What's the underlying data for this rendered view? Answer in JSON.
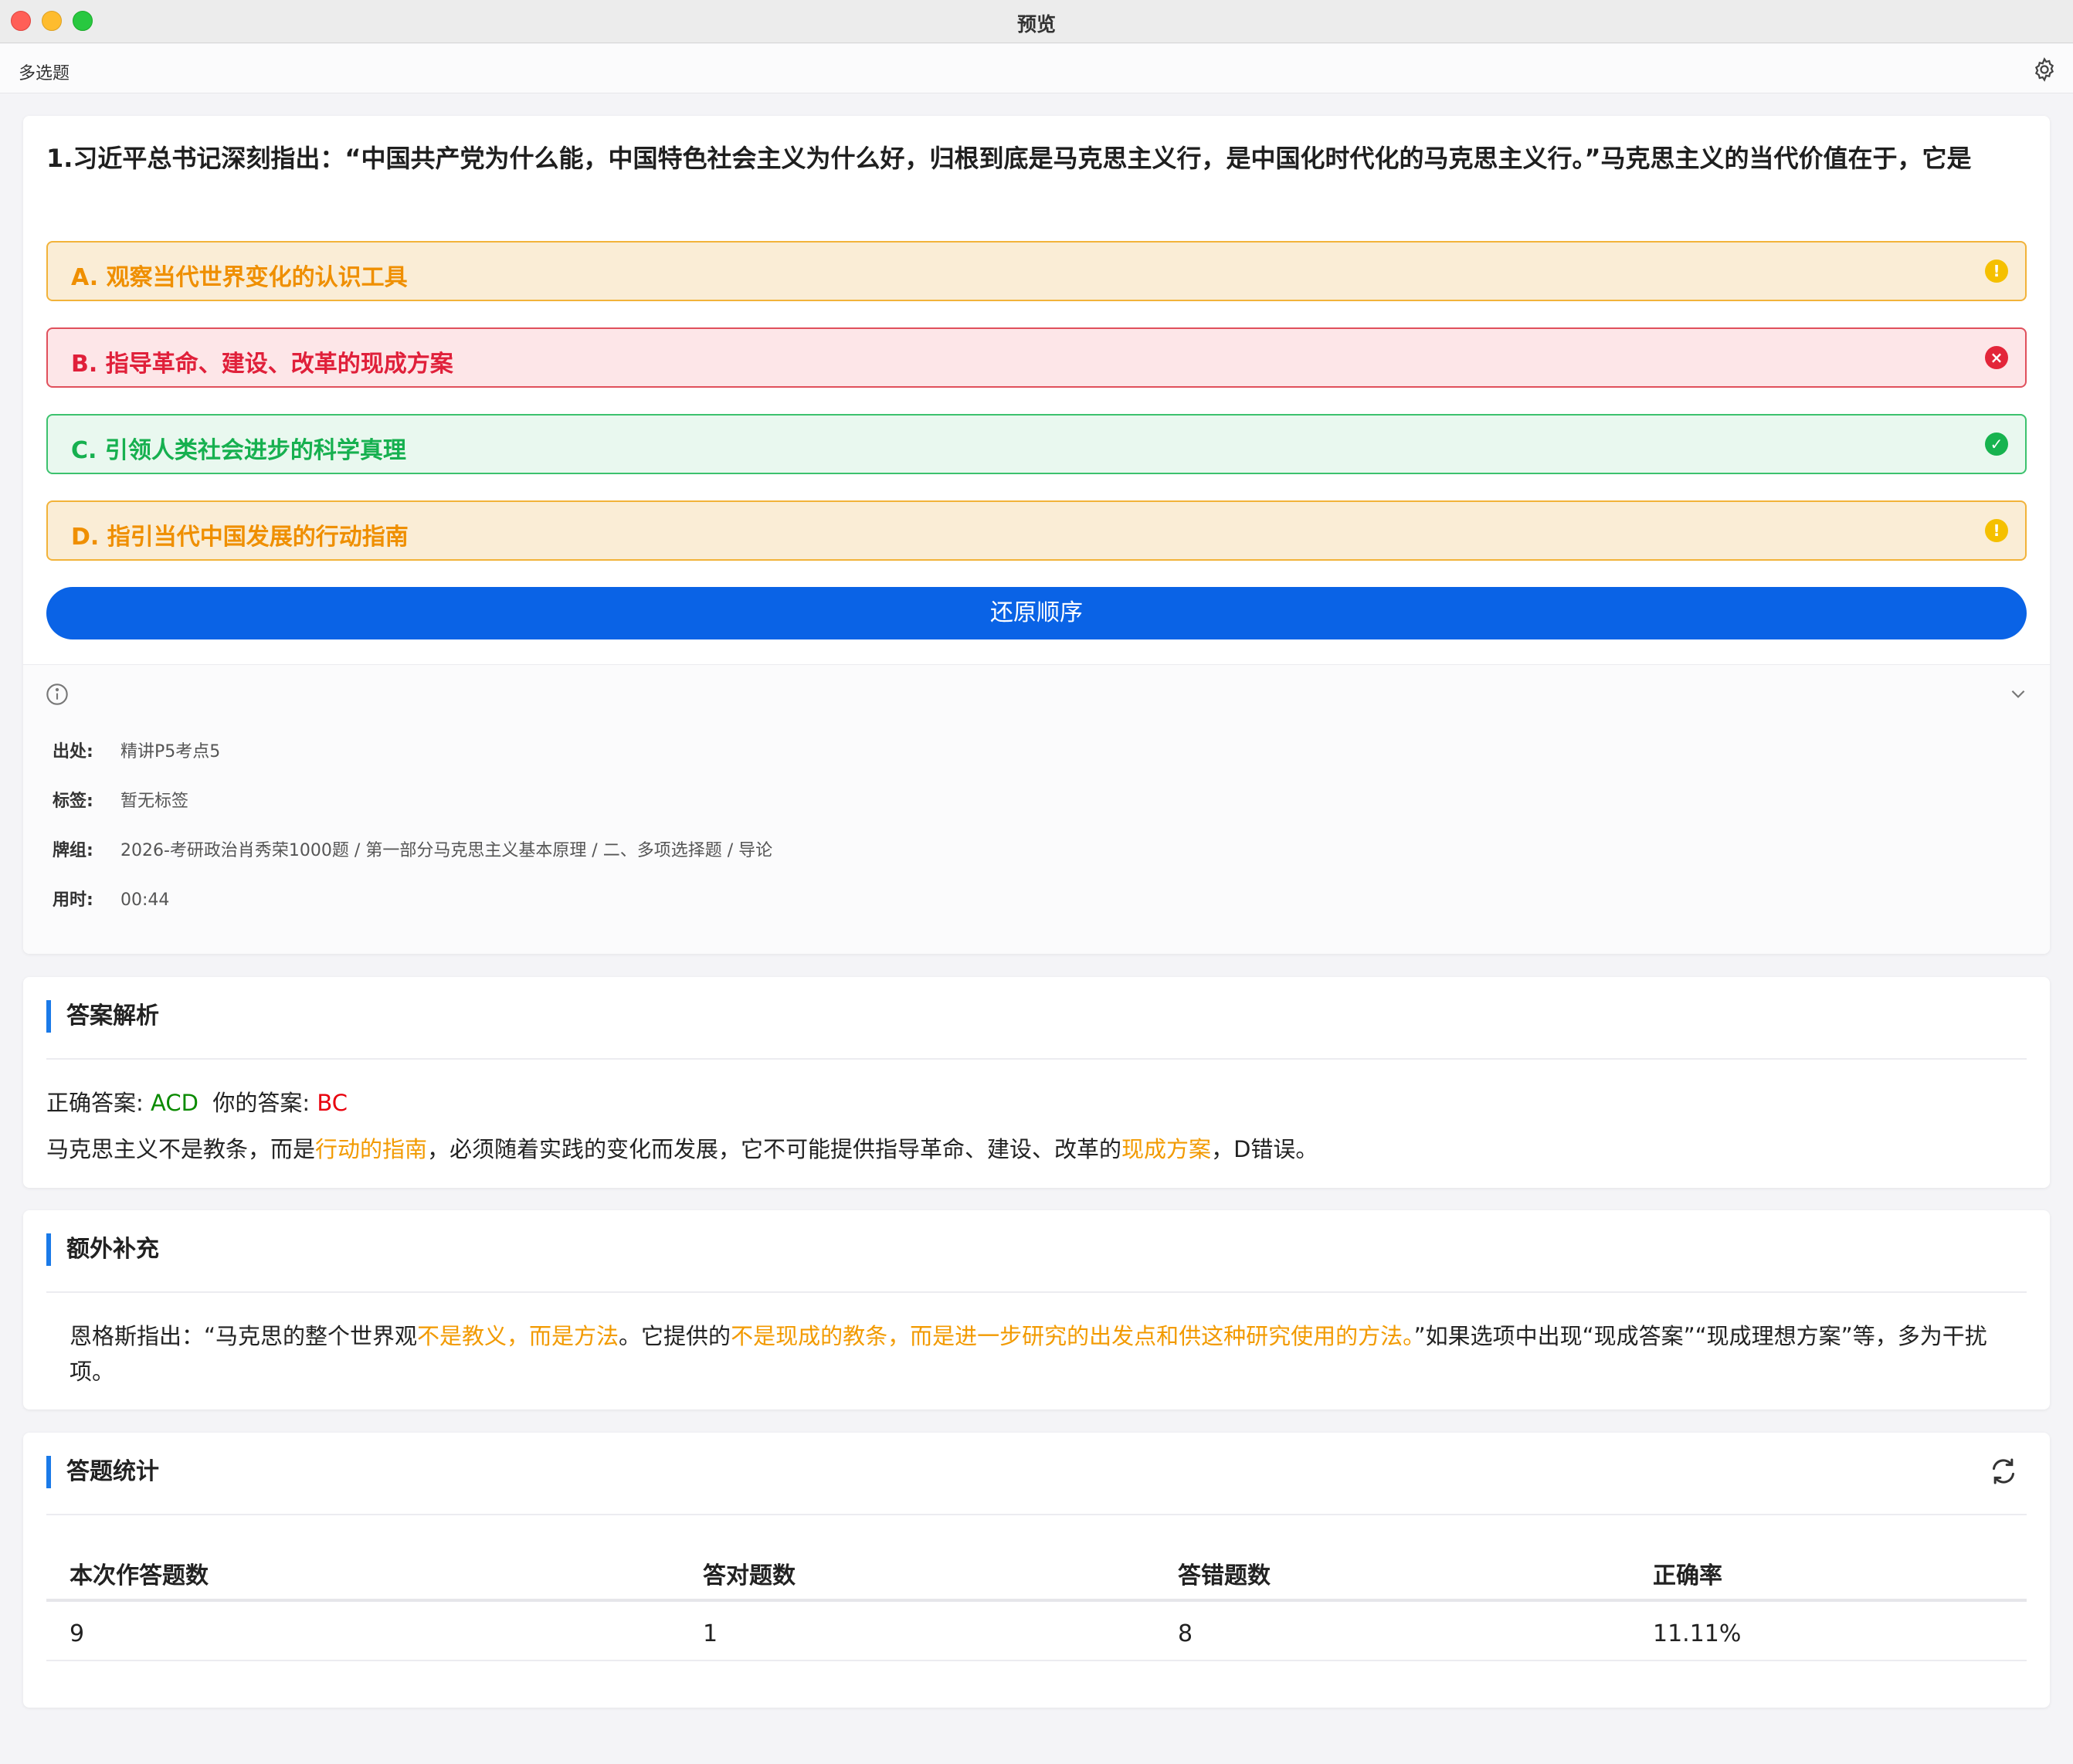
{
  "window": {
    "title": "预览"
  },
  "toolbar": {
    "title": "多选题"
  },
  "question": {
    "text": "1.习近平总书记深刻指出：“中国共产党为什么能，中国特色社会主义为什么好，归根到底是马克思主义行，是中国化时代化的马克思主义行。”马克思主义的当代价值在于，它是",
    "options": [
      {
        "label": "A. 观察当代世界变化的认识工具",
        "status": "warning",
        "icon": "warning-icon"
      },
      {
        "label": "B. 指导革命、建设、改革的现成方案",
        "status": "wrong",
        "icon": "error-icon"
      },
      {
        "label": "C. 引领人类社会进步的科学真理",
        "status": "correct",
        "icon": "check-icon"
      },
      {
        "label": "D. 指引当代中国发展的行动指南",
        "status": "warning",
        "icon": "warning-icon"
      }
    ],
    "restore_button": "还原顺序"
  },
  "meta": {
    "source_key": "出处:",
    "source_value": "精讲P5考点5",
    "tags_key": "标签:",
    "tags_value": "暂无标签",
    "deck_key": "牌组:",
    "deck_value": "2026-考研政治肖秀荣1000题 / 第一部分马克思主义基本原理 / 二、多项选择题 / 导论",
    "time_key": "用时:",
    "time_value": "00:44"
  },
  "analysis": {
    "title": "答案解析",
    "correct_label": "正确答案: ",
    "correct_value": "ACD",
    "yours_label": "你的答案: ",
    "yours_value": "BC",
    "explain": [
      {
        "text": "马克思主义不是教条，而是",
        "hl": false
      },
      {
        "text": "行动的指南",
        "hl": true
      },
      {
        "text": "，必须随着实践的变化而发展，它不可能提供指导革命、建设、改革的",
        "hl": false
      },
      {
        "text": "现成方案",
        "hl": true
      },
      {
        "text": "，D错误。",
        "hl": false
      }
    ]
  },
  "extra": {
    "title": "额外补充",
    "segments": [
      {
        "text": "恩格斯指出：“马克思的整个世界观",
        "hl": false
      },
      {
        "text": "不是教义，而是方法",
        "hl": true
      },
      {
        "text": "。它提供的",
        "hl": false
      },
      {
        "text": "不是现成的教条，而是进一步研究的出发点和供这种研究使用的方法。",
        "hl": true
      },
      {
        "text": "”如果选项中出现“现成答案”“现成理想方案”等，多为干扰项。",
        "hl": false
      }
    ]
  },
  "stats": {
    "title": "答题统计",
    "headers": [
      "本次作答题数",
      "答对题数",
      "答错题数",
      "正确率"
    ],
    "row": [
      "9",
      "1",
      "8",
      "11.11%"
    ]
  },
  "colors": {
    "accent": "#0a63e6",
    "warning": "#ef8f00",
    "wrong": "#e0203a",
    "correct": "#16b04f",
    "highlight": "#f29a00"
  }
}
